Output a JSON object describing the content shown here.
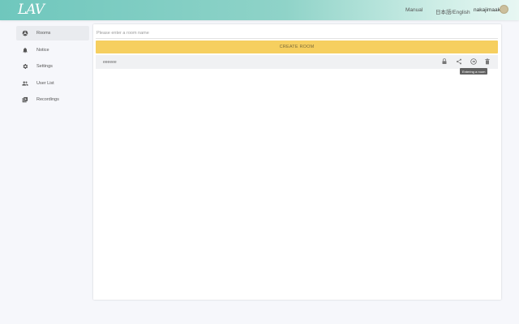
{
  "header": {
    "logo": "LAV",
    "manual": "Manual",
    "language": "日本語/English",
    "username": "nakajimaaki"
  },
  "sidebar": {
    "items": [
      {
        "label": "Rooms",
        "icon": "rooms-icon",
        "active": true
      },
      {
        "label": "Notice",
        "icon": "bell-icon",
        "active": false
      },
      {
        "label": "Settings",
        "icon": "gear-icon",
        "active": false
      },
      {
        "label": "User List",
        "icon": "people-icon",
        "active": false
      },
      {
        "label": "Recordings",
        "icon": "recordings-icon",
        "active": false
      }
    ]
  },
  "main": {
    "room_input": {
      "value": "",
      "placeholder": "Please enter a room name"
    },
    "create_button": "CREATE ROOM",
    "rooms": [
      {
        "name": "eeeeee"
      }
    ],
    "tooltip": "Entering a room"
  },
  "colors": {
    "header_gradient_start": "#6fc7bd",
    "header_gradient_end": "#e8f7f3",
    "create_button": "#f6cf5f",
    "active_item": "#e9ebef",
    "page_background": "#f6f7fb"
  }
}
